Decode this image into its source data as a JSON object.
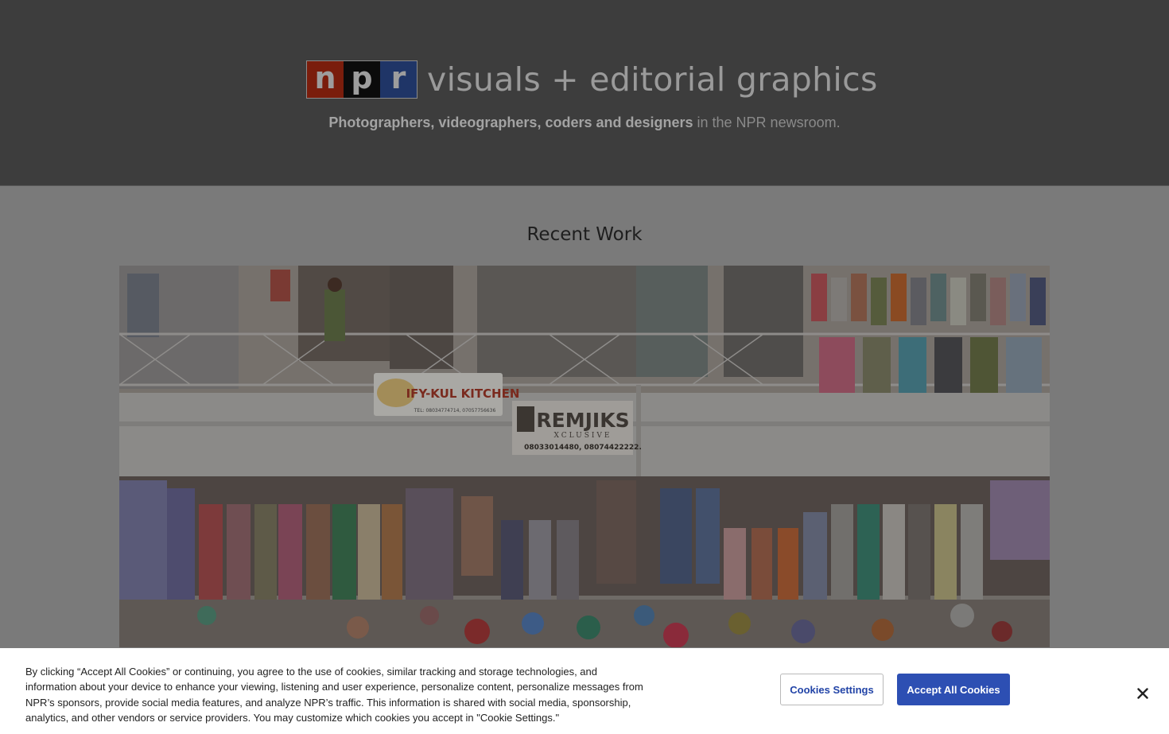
{
  "header": {
    "logo_letters": [
      "n",
      "p",
      "r"
    ],
    "title": "visuals + editorial graphics",
    "tagline_bold": "Photographers, videographers, coders and designers",
    "tagline_rest": " in the NPR newsroom."
  },
  "main": {
    "section_title": "Recent Work"
  },
  "photo": {
    "sign_kitchen": "IFY-KUL KITCHEN",
    "sign_kitchen_tel": "TEL: 08034774714, 07057756636",
    "sign_remjiks": "REMJIKS",
    "sign_remjiks_sub": "XCLUSIVE",
    "sign_remjiks_tel": "08033014480, 08074422222."
  },
  "cookie_banner": {
    "text": "By clicking “Accept All Cookies” or continuing, you agree to the use of cookies, similar tracking and storage technologies, and information about your device to enhance your viewing, listening and user experience, personalize content, personalize messages from NPR’s sponsors, provide social media features, and analyze NPR’s traffic. This information is shared with social media, sponsorship, analytics, and other vendors or service providers. You may customize which cookies you accept in \"Cookie Settings.\"",
    "settings_label": "Cookies Settings",
    "accept_label": "Accept All Cookies",
    "close_icon": "close-icon"
  },
  "colors": {
    "header_bg": "#3d3d3d",
    "page_bg": "#7a7a7a",
    "accept_button": "#2d4fb3",
    "settings_text": "#2244a7"
  }
}
